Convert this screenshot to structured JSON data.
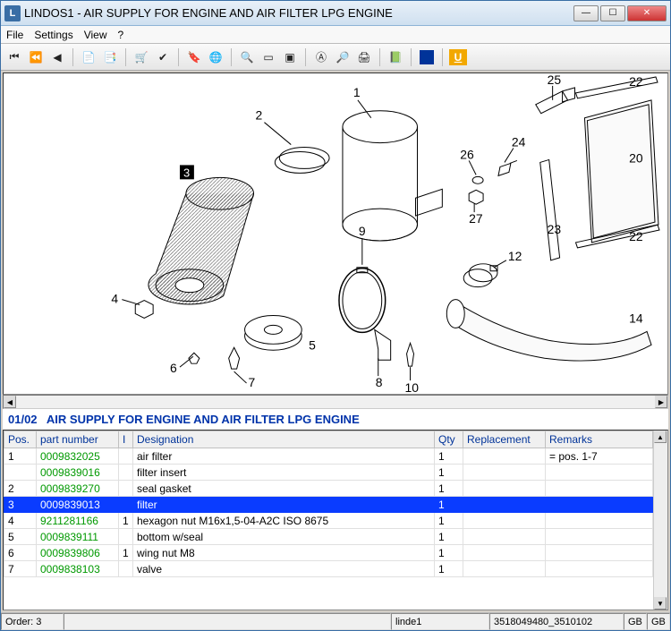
{
  "window": {
    "title": "LINDOS1 - AIR SUPPLY FOR ENGINE AND AIR FILTER LPG ENGINE"
  },
  "menu": {
    "file": "File",
    "settings": "Settings",
    "view": "View",
    "help": "?"
  },
  "section": {
    "code": "01/02",
    "title": "AIR SUPPLY FOR ENGINE AND AIR FILTER LPG ENGINE"
  },
  "diagramLabels": {
    "l1": "1",
    "l2": "2",
    "l3": "3",
    "l4": "4",
    "l5": "5",
    "l6": "6",
    "l7": "7",
    "l8": "8",
    "l9": "9",
    "l10": "10",
    "l12": "12",
    "l14": "14",
    "l20": "20",
    "l22a": "22",
    "l22b": "22",
    "l23": "23",
    "l24": "24",
    "l25": "25",
    "l26": "26",
    "l27": "27"
  },
  "cols": {
    "pos": "Pos.",
    "part": "part number",
    "i": "I",
    "desig": "Designation",
    "qty": "Qty",
    "repl": "Replacement",
    "rem": "Remarks"
  },
  "rows": [
    {
      "pos": "1",
      "part": "0009832025",
      "i": "",
      "desig": "air filter",
      "qty": "1",
      "repl": "",
      "rem": "= pos. 1-7"
    },
    {
      "pos": "",
      "part": "0009839016",
      "i": "",
      "desig": "filter insert",
      "qty": "1",
      "repl": "",
      "rem": ""
    },
    {
      "pos": "2",
      "part": "0009839270",
      "i": "",
      "desig": "seal gasket",
      "qty": "1",
      "repl": "",
      "rem": ""
    },
    {
      "pos": "3",
      "part": "0009839013",
      "i": "",
      "desig": "filter",
      "qty": "1",
      "repl": "",
      "rem": "",
      "selected": true
    },
    {
      "pos": "4",
      "part": "9211281166",
      "i": "1",
      "desig": "hexagon nut M16x1,5-04-A2C  ISO 8675",
      "qty": "1",
      "repl": "",
      "rem": ""
    },
    {
      "pos": "5",
      "part": "0009839111",
      "i": "",
      "desig": "bottom w/seal",
      "qty": "1",
      "repl": "",
      "rem": ""
    },
    {
      "pos": "6",
      "part": "0009839806",
      "i": "1",
      "desig": "wing nut M8",
      "qty": "1",
      "repl": "",
      "rem": ""
    },
    {
      "pos": "7",
      "part": "0009838103",
      "i": "",
      "desig": "valve",
      "qty": "1",
      "repl": "",
      "rem": ""
    }
  ],
  "status": {
    "order": "Order: 3",
    "user": "linde1",
    "code": "3518049480_3510102",
    "lang1": "GB",
    "lang2": "GB"
  }
}
